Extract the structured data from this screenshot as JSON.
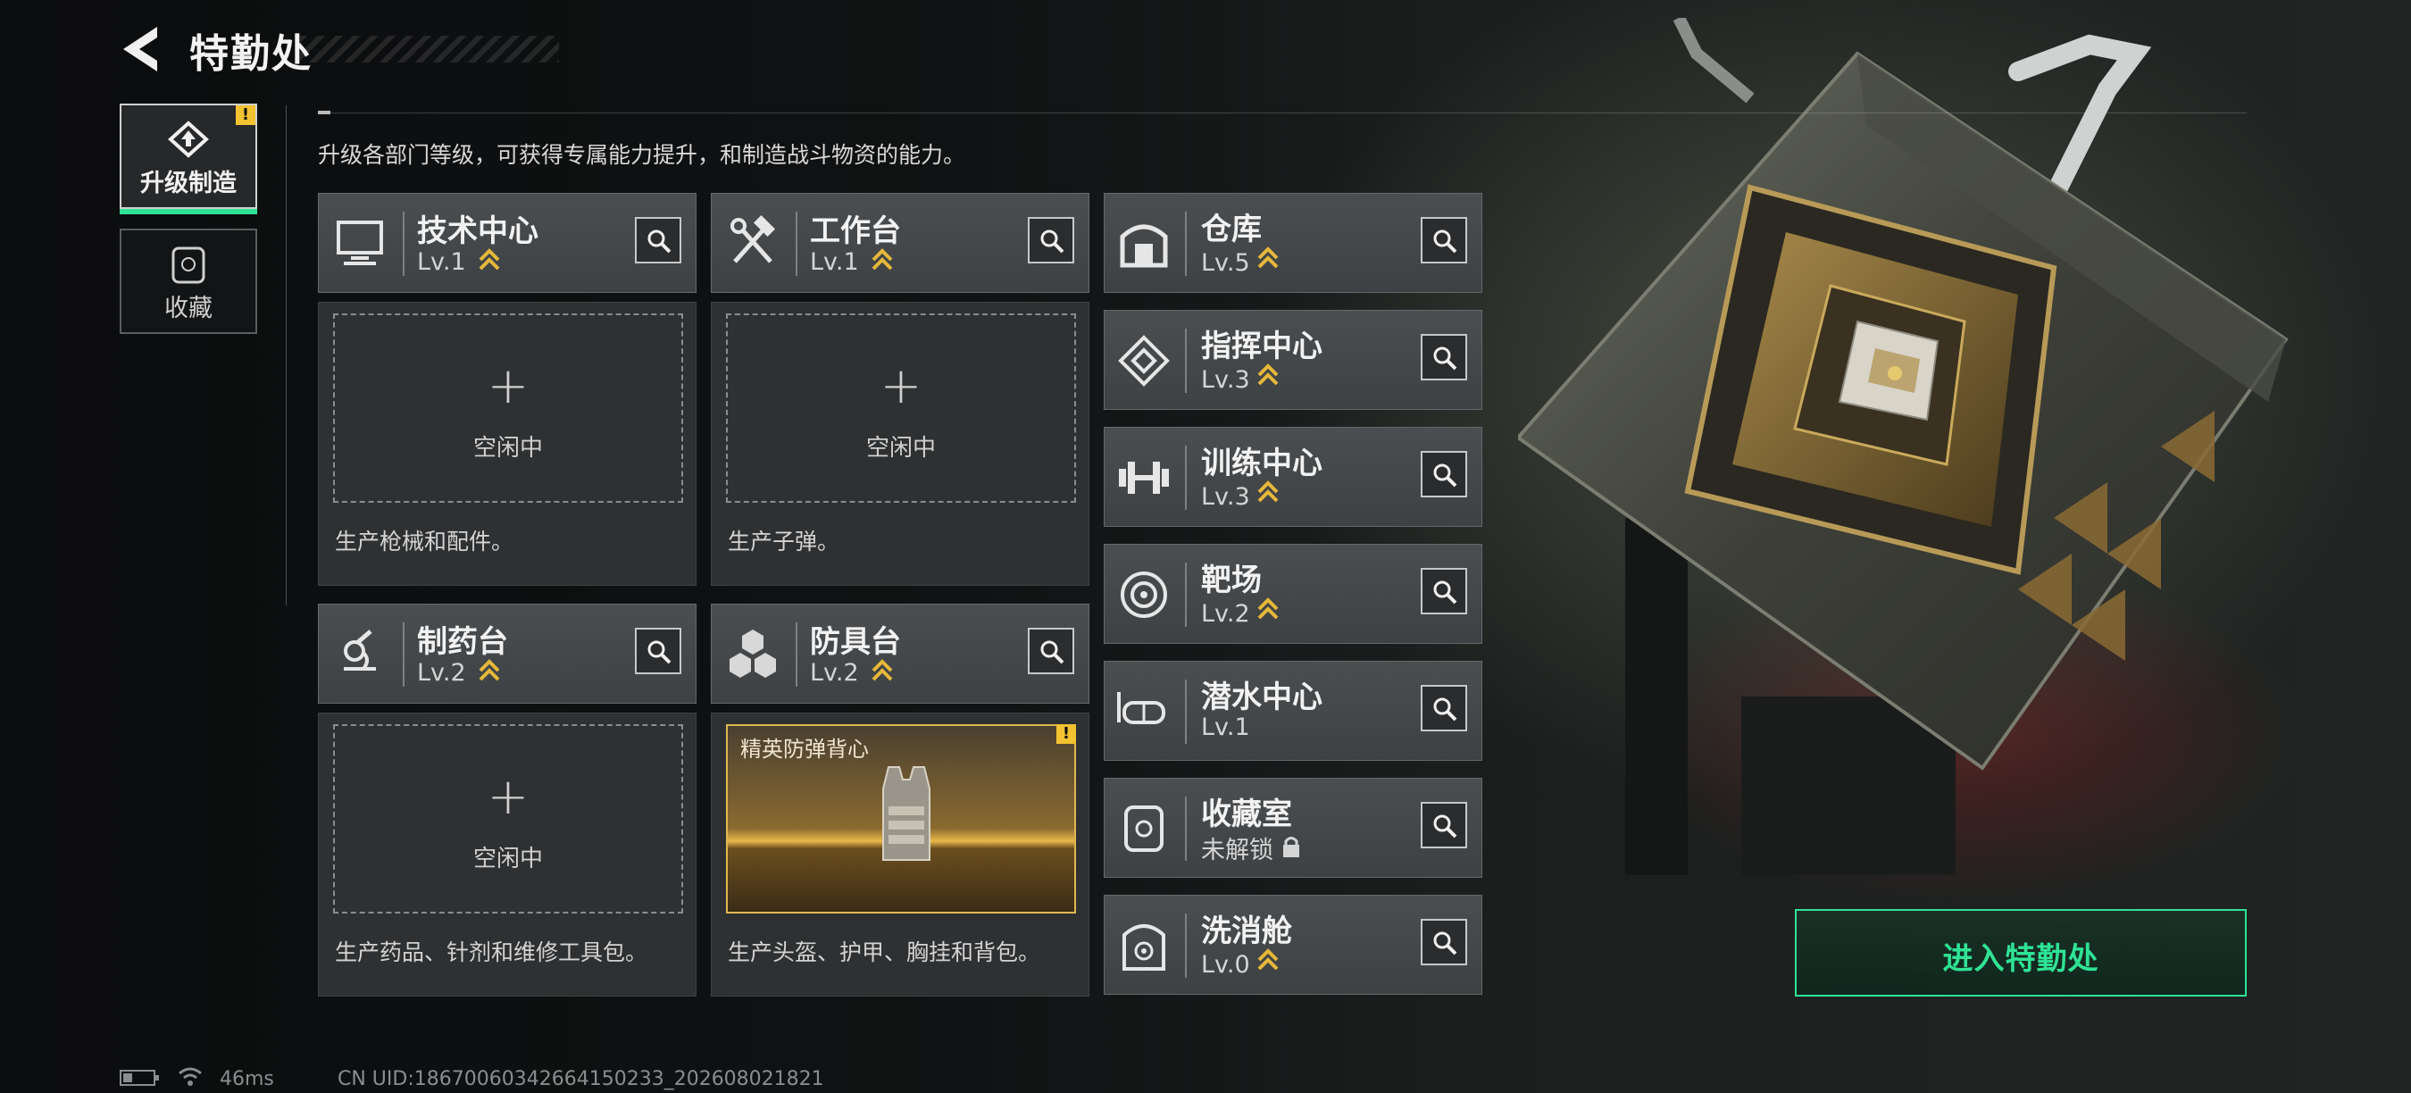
{
  "header": {
    "title": "特勤处"
  },
  "tabs": [
    {
      "label": "升级制造",
      "badge": "!"
    },
    {
      "label": "收藏"
    }
  ],
  "subtitle": "升级各部门等级，可获得专属能力提升，和制造战斗物资的能力。",
  "facilities_main": [
    {
      "name": "技术中心",
      "level": "Lv.1",
      "slot_state": "空闲中",
      "slot_plus": "+",
      "description": "生产枪械和配件。"
    },
    {
      "name": "工作台",
      "level": "Lv.1",
      "slot_state": "空闲中",
      "slot_plus": "+",
      "description": "生产子弹。"
    },
    {
      "name": "制药台",
      "level": "Lv.2",
      "slot_state": "空闲中",
      "slot_plus": "+",
      "description": "生产药品、针剂和维修工具包。"
    },
    {
      "name": "防具台",
      "level": "Lv.2",
      "crafting_item": "精英防弹背心",
      "badge": "!",
      "description": "生产头盔、护甲、胸挂和背包。"
    }
  ],
  "facilities_side": [
    {
      "name": "仓库",
      "level": "Lv.5",
      "icon": "warehouse-icon"
    },
    {
      "name": "指挥中心",
      "level": "Lv.3",
      "icon": "command-icon"
    },
    {
      "name": "训练中心",
      "level": "Lv.3",
      "icon": "dumbbell-icon"
    },
    {
      "name": "靶场",
      "level": "Lv.2",
      "icon": "target-icon"
    },
    {
      "name": "潜水中心",
      "level": "Lv.1",
      "icon": "diving-mask-icon"
    },
    {
      "name": "收藏室",
      "level": "未解锁",
      "icon": "collection-icon"
    },
    {
      "name": "洗消舱",
      "level": "Lv.0",
      "icon": "decon-icon"
    }
  ],
  "enter_button": "进入特勤处",
  "status": {
    "ping": "46ms",
    "uid": "CN UID:18670060342664150233_202608021821"
  },
  "colors": {
    "accent_green": "#2fe394",
    "warning_yellow": "#f2c230",
    "upgrade_gold": "#e6b83a"
  }
}
